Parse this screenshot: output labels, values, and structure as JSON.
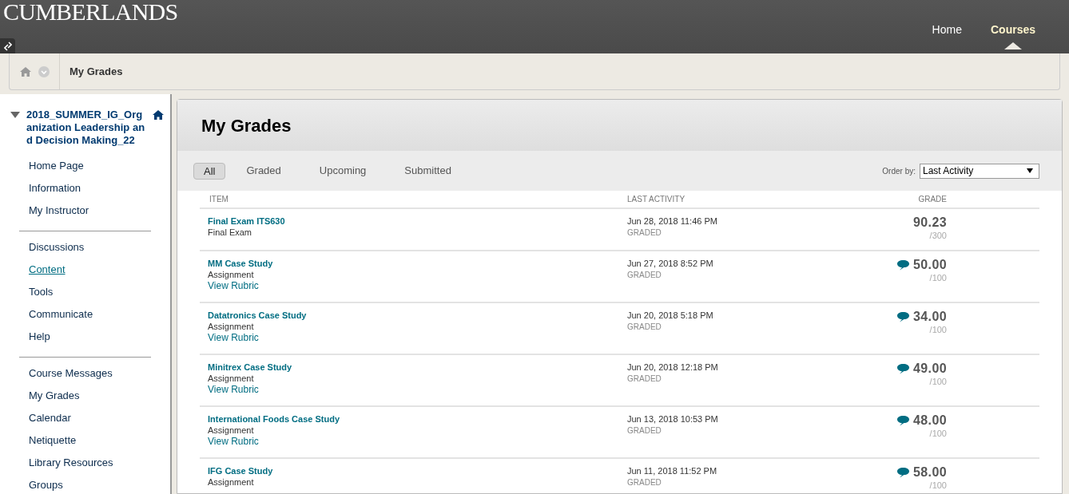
{
  "header": {
    "logo": "CUMBERLANDS",
    "nav": [
      {
        "label": "Home",
        "selected": false
      },
      {
        "label": "Courses",
        "selected": true
      }
    ]
  },
  "breadcrumb": {
    "label": "My Grades"
  },
  "sidebar": {
    "course": {
      "title": "2018_SUMMER_IG_Organization Leadership and Decision Making_22",
      "expanded": true
    },
    "groups": [
      [
        {
          "label": "Home Page",
          "selected": false
        },
        {
          "label": "Information",
          "selected": false
        },
        {
          "label": "My Instructor",
          "selected": false
        }
      ],
      [
        {
          "label": "Discussions",
          "selected": false
        },
        {
          "label": "Content",
          "selected": true
        },
        {
          "label": "Tools",
          "selected": false
        },
        {
          "label": "Communicate",
          "selected": false
        },
        {
          "label": "Help",
          "selected": false
        }
      ],
      [
        {
          "label": "Course Messages",
          "selected": false
        },
        {
          "label": "My Grades",
          "selected": false
        },
        {
          "label": "Calendar",
          "selected": false
        },
        {
          "label": "Netiquette",
          "selected": false
        },
        {
          "label": "Library Resources",
          "selected": false
        },
        {
          "label": "Groups",
          "selected": false
        }
      ]
    ]
  },
  "main": {
    "title": "My Grades",
    "filters": [
      {
        "label": "All",
        "selected": true
      },
      {
        "label": "Graded",
        "selected": false
      },
      {
        "label": "Upcoming",
        "selected": false
      },
      {
        "label": "Submitted",
        "selected": false
      }
    ],
    "order_by": {
      "label": "Order by:",
      "value": "Last Activity"
    },
    "table": {
      "columns": [
        "ITEM",
        "LAST ACTIVITY",
        "GRADE"
      ],
      "rows": [
        {
          "name": "Final Exam ITS630",
          "type": "Final Exam",
          "date": "Jun 28, 2018 11:46 PM",
          "status": "GRADED",
          "grade": "90.23",
          "max": "/300",
          "has_comment": false
        },
        {
          "name": "MM Case Study",
          "type": "Assignment",
          "rubric": "View Rubric",
          "date": "Jun 27, 2018 8:52 PM",
          "status": "GRADED",
          "grade": "50.00",
          "max": "/100",
          "has_comment": true
        },
        {
          "name": "Datatronics Case Study",
          "type": "Assignment",
          "rubric": "View Rubric",
          "date": "Jun 20, 2018 5:18 PM",
          "status": "GRADED",
          "grade": "34.00",
          "max": "/100",
          "has_comment": true
        },
        {
          "name": "Minitrex Case Study",
          "type": "Assignment",
          "rubric": "View Rubric",
          "date": "Jun 20, 2018 12:18 PM",
          "status": "GRADED",
          "grade": "49.00",
          "max": "/100",
          "has_comment": true
        },
        {
          "name": "International Foods Case Study",
          "type": "Assignment",
          "rubric": "View Rubric",
          "date": "Jun 13, 2018 10:53 PM",
          "status": "GRADED",
          "grade": "48.00",
          "max": "/100",
          "has_comment": true
        },
        {
          "name": "IFG Case Study",
          "type": "Assignment",
          "date": "Jun 11, 2018 11:52 PM",
          "status": "GRADED",
          "grade": "58.00",
          "max": "/100",
          "has_comment": true
        }
      ]
    }
  }
}
